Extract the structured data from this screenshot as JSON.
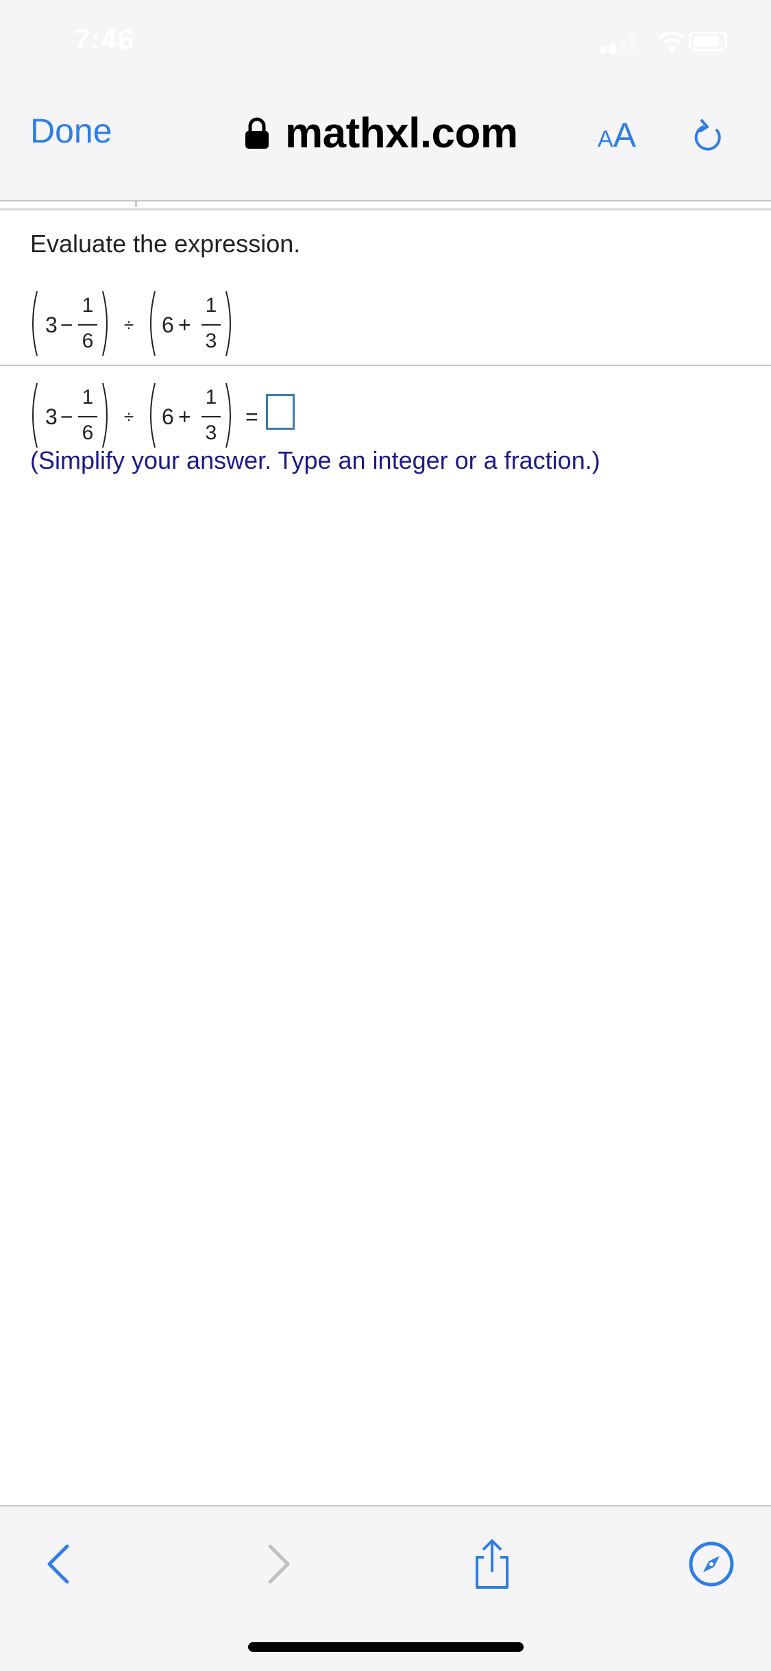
{
  "status_bar": {
    "time": "7:46"
  },
  "browser": {
    "done_label": "Done",
    "url": "mathxl.com",
    "aa_label_small": "A",
    "aa_label_large": "A",
    "accent_color": "#2f7ee6"
  },
  "question": {
    "instruction": "Evaluate the expression.",
    "expression": {
      "left_whole": "3",
      "left_op": "−",
      "left_num": "1",
      "left_den": "6",
      "divide_op": "÷",
      "right_whole": "6",
      "right_op": "+",
      "right_num": "1",
      "right_den": "3",
      "equals": "="
    },
    "answer": {
      "value": ""
    },
    "hint": "(Simplify your answer. Type an integer or a fraction.)"
  },
  "toolbar": {
    "icons": [
      "back-icon",
      "forward-icon",
      "share-icon",
      "compass-icon"
    ]
  }
}
